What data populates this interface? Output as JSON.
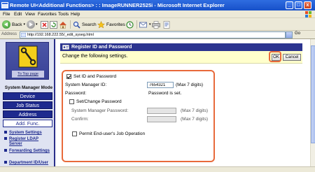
{
  "window": {
    "title": "Remote UI<Additional Functions> : : ImageRUNNER2525i - Microsoft Internet Explorer",
    "min_label": "_",
    "max_label": "□",
    "close_label": "x"
  },
  "menu": {
    "items": [
      "File",
      "Edit",
      "View",
      "Favorites",
      "Tools",
      "Help"
    ]
  },
  "toolbar": {
    "back_label": "Back",
    "search_label": "Search",
    "favorites_label": "Favorites"
  },
  "address": {
    "label": "Address",
    "url": "http://192.168.222.55/_edit_syseg.html",
    "go_label": "Go"
  },
  "nav": {
    "top_page_label": "To Top page",
    "mode_title": "System Manager Mode",
    "buttons": [
      "Device",
      "Job Status",
      "Address",
      "Add. Func."
    ],
    "active_button": "Add. Func.",
    "subitems": [
      "System Settings",
      "Register LDAP Server",
      "Forwarding Settings",
      "Department ID/User"
    ]
  },
  "panel": {
    "title": "Register ID and Password",
    "instruction": "Change the following settings.",
    "ok_label": "OK",
    "cancel_label": "Cancel"
  },
  "settings": {
    "set_id_password_label": "Set ID and Password",
    "set_id_password_checked": true,
    "system_manager_id_label": "System Manager ID:",
    "system_manager_id_value": "7654321",
    "system_manager_id_hint": "(Max 7 digits)",
    "password_label": "Password:",
    "password_status": "Password is set.",
    "set_change_password_label": "Set/Change Password",
    "set_change_password_checked": false,
    "sm_password_label": "System Manager Password:",
    "sm_password_hint": "(Max 7 digits)",
    "confirm_label": "Confirm:",
    "confirm_hint": "(Max 7 digits)",
    "permit_end_user_label": "Permit End-user's Job Operation",
    "permit_end_user_checked": false
  },
  "colors": {
    "nav_blue": "#1e2a8e",
    "highlight_orange": "#e86a3b",
    "instruction_bg": "#ffffcc"
  }
}
